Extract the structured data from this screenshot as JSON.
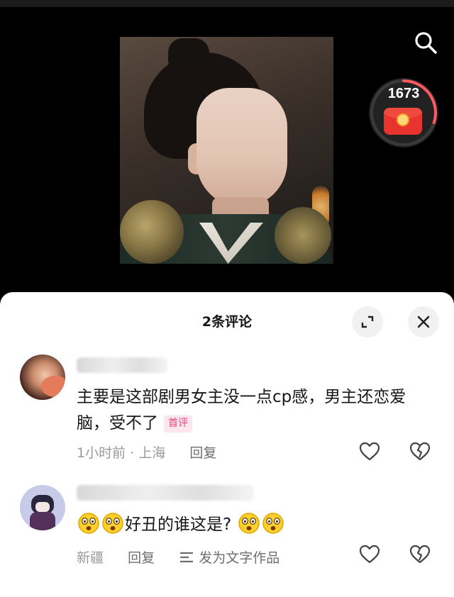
{
  "video": {
    "search_icon": "search-icon",
    "red_packet": {
      "count": "1673",
      "color": "#e8332e",
      "progress_ring_color": "#ff5a5f",
      "progress_fraction": 0.3
    }
  },
  "comments_sheet": {
    "title": "2条评论",
    "expand_icon": "expand-icon",
    "close_icon": "close-icon",
    "comments": [
      {
        "text": "主要是这部剧男女主没一点cp感，男主还恋爱脑，受不了",
        "badge": "首评",
        "time": "1小时前",
        "separator": "·",
        "location": "上海",
        "reply_label": "回复"
      },
      {
        "text": "好丑的谁这是?",
        "emoji_before_count": 2,
        "emoji_after_count": 2,
        "location": "新疆",
        "reply_label": "回复",
        "publish_label": "发为文字作品"
      }
    ]
  },
  "colors": {
    "badge_text": "#e2467b",
    "badge_bg": "#fde6ee",
    "meta_text": "#9a9a9a"
  }
}
